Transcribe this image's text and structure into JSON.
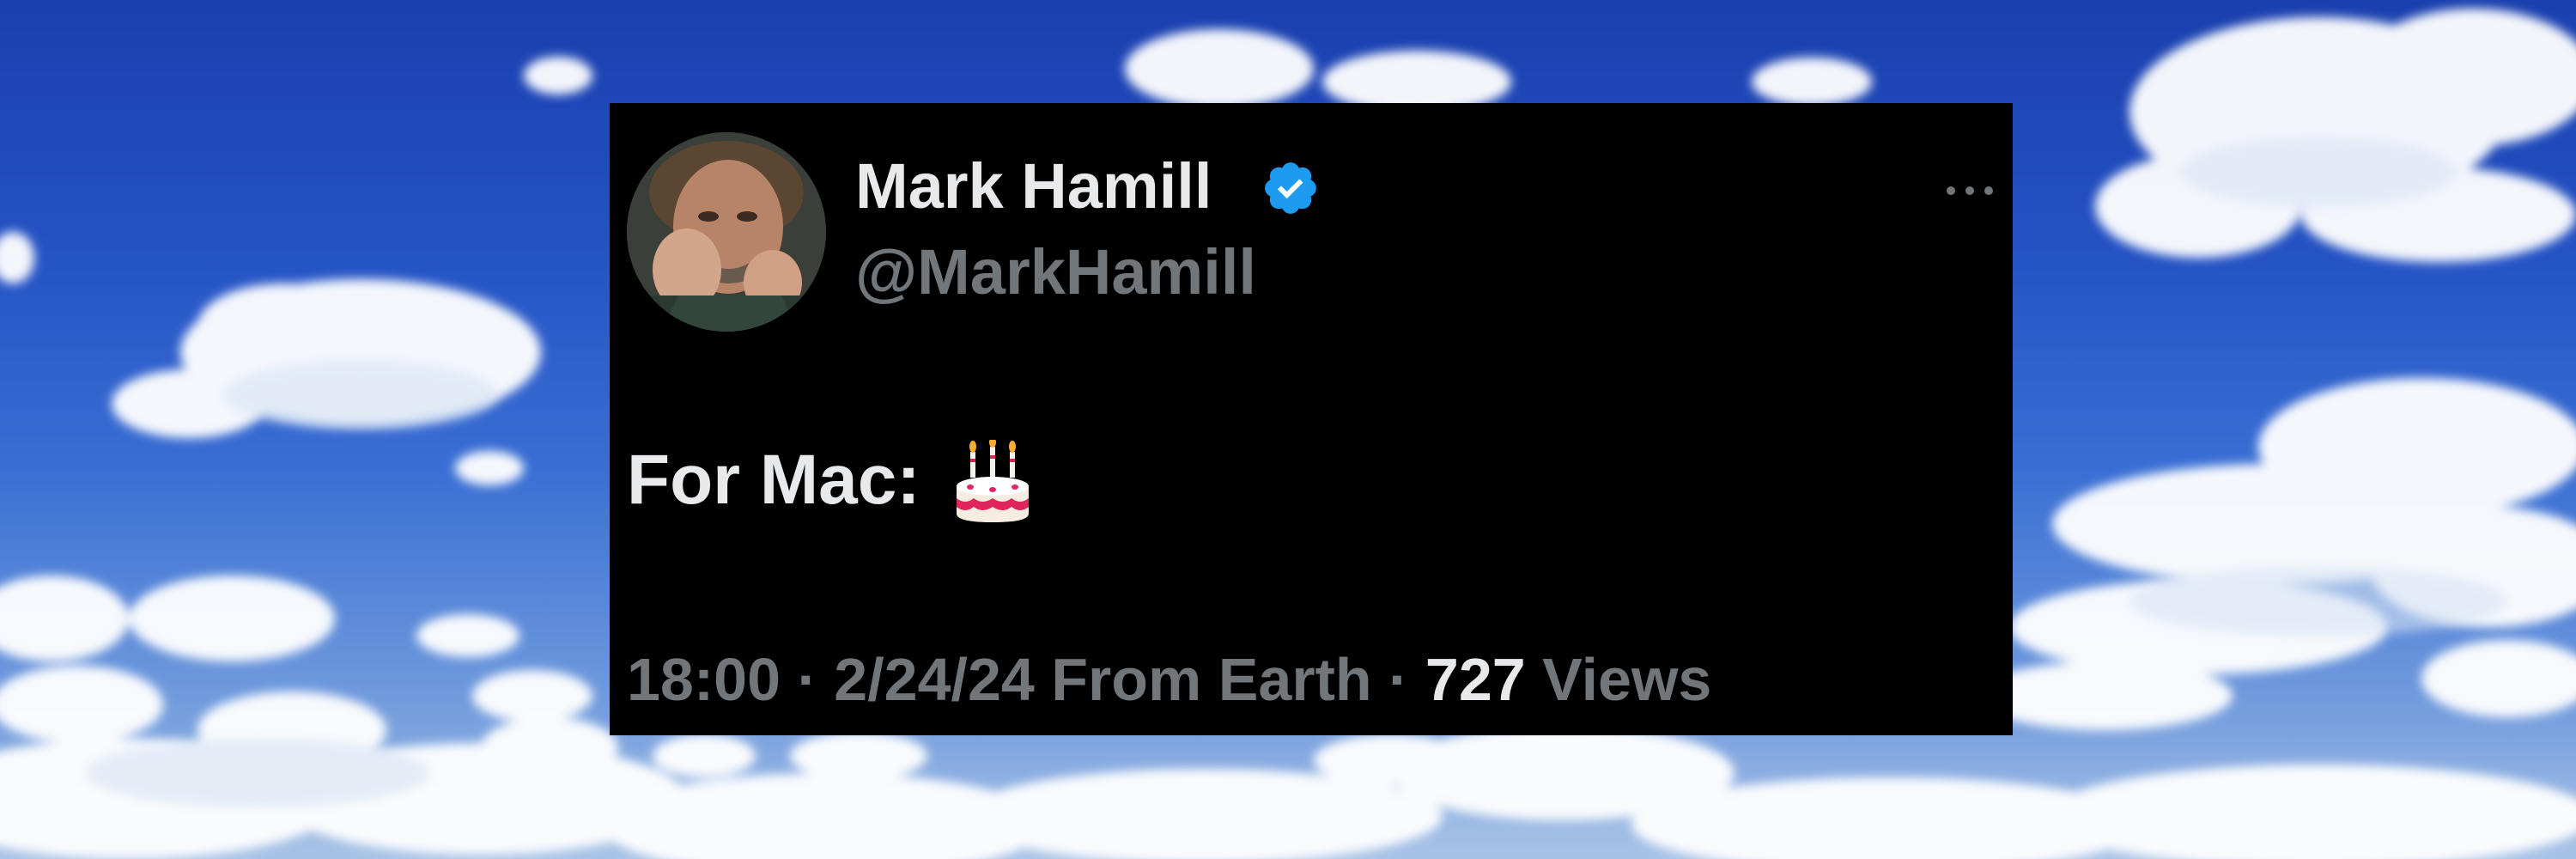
{
  "tweet": {
    "display_name": "Mark Hamill",
    "handle": "@MarkHamill",
    "text": "For Mac:",
    "emoji": "birthday-cake",
    "time": "18:00",
    "separator": "·",
    "date": "2/24/24",
    "location": "From Earth",
    "views_count": "727",
    "views_label": "Views"
  },
  "icons": {
    "verified": "verified-badge",
    "more": "more-dots",
    "avatar": "profile-photo"
  },
  "colors": {
    "card_bg": "#000000",
    "primary_text": "#e7e9ea",
    "secondary_text": "#71767b",
    "verified_blue": "#1d9bf0"
  }
}
